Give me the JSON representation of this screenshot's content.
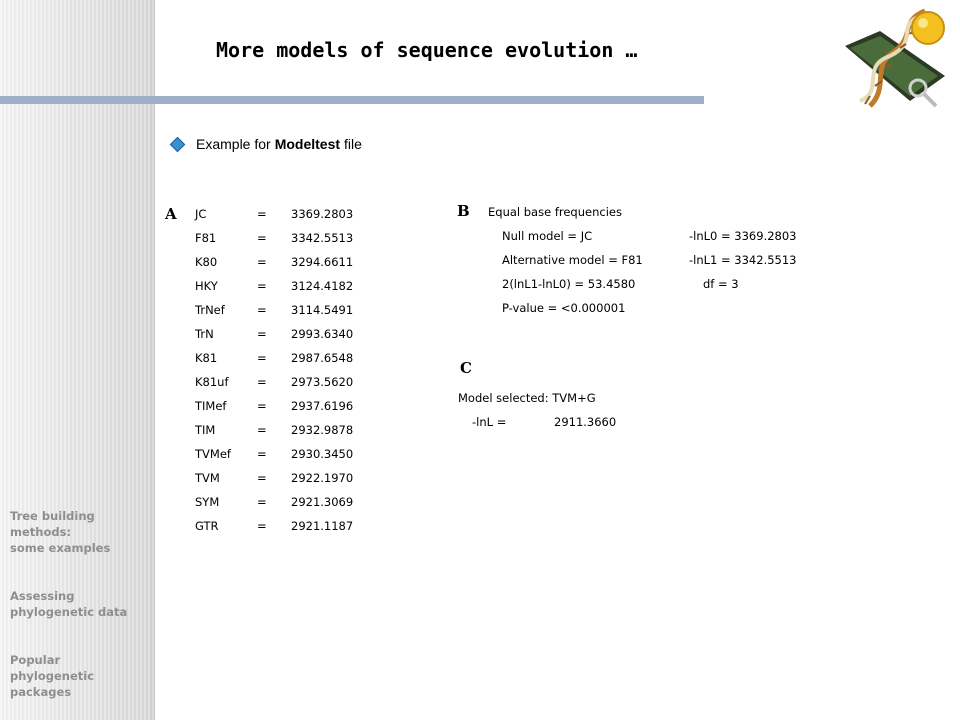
{
  "title": "More models of sequence evolution …",
  "bullet": {
    "prefix": "Example for",
    "bold": "Modeltest",
    "suffix": "file"
  },
  "side_nav": {
    "item1_line1": "Tree building",
    "item1_line2": "methods:",
    "item1_line3": "some examples",
    "item2_line1": "Assessing",
    "item2_line2": "phylogenetic data",
    "item3_line1": "Popular",
    "item3_line2": "phylogenetic",
    "item3_line3": "packages"
  },
  "panel_a": {
    "letter": "A",
    "rows": [
      {
        "model": "JC",
        "value": "3369.2803"
      },
      {
        "model": "F81",
        "value": "3342.5513"
      },
      {
        "model": "K80",
        "value": "3294.6611"
      },
      {
        "model": "HKY",
        "value": "3124.4182"
      },
      {
        "model": "TrNef",
        "value": "3114.5491"
      },
      {
        "model": "TrN",
        "value": "2993.6340"
      },
      {
        "model": "K81",
        "value": "2987.6548"
      },
      {
        "model": "K81uf",
        "value": "2973.5620"
      },
      {
        "model": "TIMef",
        "value": "2937.6196"
      },
      {
        "model": "TIM",
        "value": "2932.9878"
      },
      {
        "model": "TVMef",
        "value": "2930.3450"
      },
      {
        "model": "TVM",
        "value": "2922.1970"
      },
      {
        "model": "SYM",
        "value": "2921.3069"
      },
      {
        "model": "GTR",
        "value": "2921.1187"
      }
    ],
    "equals": "="
  },
  "panel_b": {
    "letter": "B",
    "heading": "Equal base frequencies",
    "null_model": "Null model = JC",
    "null_lnl": "-lnL0 = 3369.2803",
    "alt_model": "Alternative model = F81",
    "alt_lnl": "-lnL1 = 3342.5513",
    "lr": "2(lnL1-lnL0) = 53.4580",
    "df": "df = 3",
    "pvalue": "P-value = <0.000001"
  },
  "panel_c": {
    "letter": "C",
    "selected": "Model selected: TVM+G",
    "lnl_label": "-lnL =",
    "lnl_value": "2911.3660"
  },
  "colors": {
    "title_bar": "#9db0c8",
    "side_nav_text": "#8e8e8e",
    "bullet": "#3a8fd0"
  }
}
